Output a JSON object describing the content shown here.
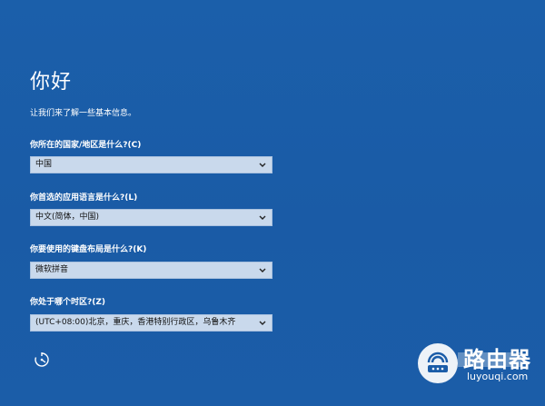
{
  "greeting": "你好",
  "subtitle": "让我们来了解一些基本信息。",
  "questions": [
    {
      "label": "你所在的国家/地区是什么?(C)",
      "value": "中国"
    },
    {
      "label": "你首选的应用语言是什么?(L)",
      "value": "中文(简体，中国)"
    },
    {
      "label": "你要使用的键盘布局是什么?(K)",
      "value": "微软拼音"
    },
    {
      "label": "你处于哪个时区?(Z)",
      "value": "(UTC+08:00)北京，重庆，香港特别行政区，乌鲁木齐"
    }
  ],
  "icons": {
    "accessibility": "accessibility-icon",
    "dropdown": "chevron-down-icon",
    "watermark": "router-logo-icon"
  },
  "watermark": {
    "name": "路由器",
    "url": "luyouqi.com"
  },
  "colors": {
    "background": "#1a5ca8",
    "select_bg": "#c9d9ec"
  }
}
